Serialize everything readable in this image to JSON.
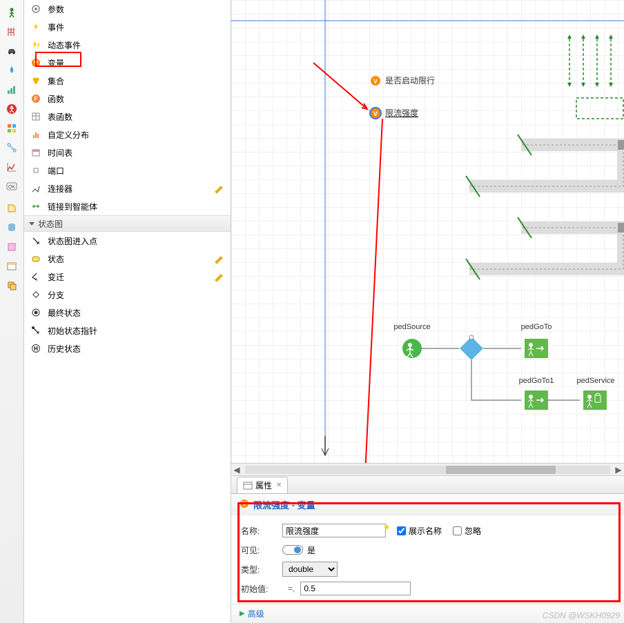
{
  "palette": {
    "items": [
      {
        "label": "参数",
        "icon": "param"
      },
      {
        "label": "事件",
        "icon": "bolt"
      },
      {
        "label": "动态事件",
        "icon": "dyn-bolt"
      },
      {
        "label": "变量",
        "icon": "var"
      },
      {
        "label": "集合",
        "icon": "set"
      },
      {
        "label": "函数",
        "icon": "fn"
      },
      {
        "label": "表函数",
        "icon": "table"
      },
      {
        "label": "自定义分布",
        "icon": "dist"
      },
      {
        "label": "时间表",
        "icon": "sched"
      },
      {
        "label": "端口",
        "icon": "port"
      },
      {
        "label": "连接器",
        "icon": "conn",
        "editable": true
      },
      {
        "label": "链接到智能体",
        "icon": "link"
      }
    ],
    "section": "状态图",
    "state_items": [
      {
        "label": "状态图进入点",
        "icon": "entry"
      },
      {
        "label": "状态",
        "icon": "state",
        "editable": true
      },
      {
        "label": "变迁",
        "icon": "trans",
        "editable": true
      },
      {
        "label": "分支",
        "icon": "branch"
      },
      {
        "label": "最终状态",
        "icon": "final"
      },
      {
        "label": "初始状态指针",
        "icon": "init"
      },
      {
        "label": "历史状态",
        "icon": "hist"
      }
    ]
  },
  "canvas": {
    "var1": "是否启动限行",
    "var2": "限流强度",
    "blocks": {
      "pedSource": "pedSource",
      "pedGoTo": "pedGoTo",
      "pedGoTo1": "pedGoTo1",
      "pedService": "pedService"
    }
  },
  "props": {
    "tab_label": "属性",
    "title_name": "限流强度",
    "title_type": "变量",
    "row_name": "名称:",
    "name_value": "限流强度",
    "show_label": "展示名称",
    "ignore_label": "忽略",
    "row_visible": "可见:",
    "visible_value": "是",
    "row_type": "类型:",
    "type_value": "double",
    "row_init": "初始值:",
    "init_value": "0.5",
    "advanced": "高级"
  },
  "watermark": "CSDN @WSKH0929"
}
